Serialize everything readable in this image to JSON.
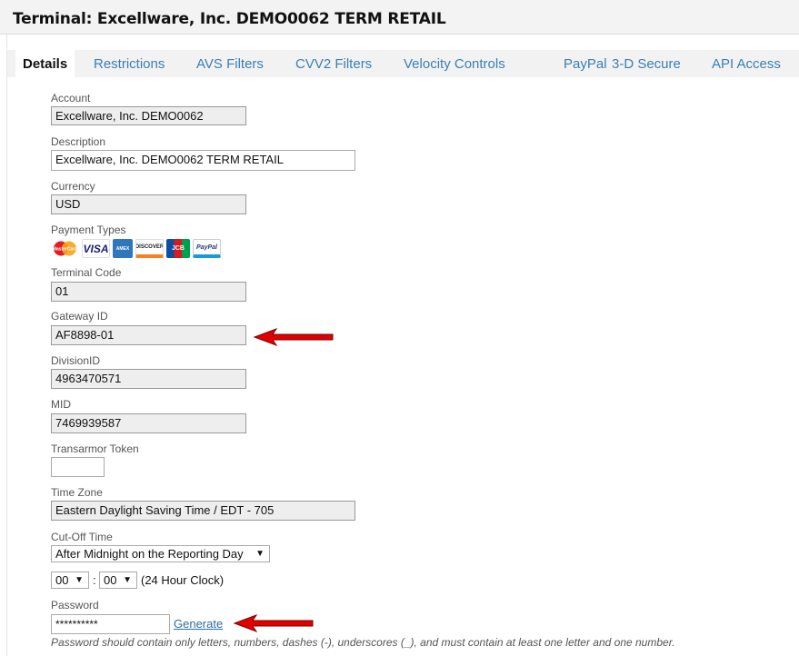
{
  "page": {
    "title": "Terminal: Excellware, Inc. DEMO0062 TERM RETAIL"
  },
  "tabs": [
    {
      "label": "Details"
    },
    {
      "label": "Restrictions"
    },
    {
      "label": "AVS Filters"
    },
    {
      "label": "CVV2 Filters"
    },
    {
      "label": "Velocity Controls"
    },
    {
      "label": "PayPal"
    },
    {
      "label": "3-D Secure"
    },
    {
      "label": "API Access"
    }
  ],
  "fields": {
    "account": {
      "label": "Account",
      "value": "Excellware, Inc. DEMO0062"
    },
    "description": {
      "label": "Description",
      "value": "Excellware, Inc. DEMO0062 TERM RETAIL"
    },
    "currency": {
      "label": "Currency",
      "value": "USD"
    },
    "payment_types": {
      "label": "Payment Types",
      "cards": [
        "MasterCard",
        "VISA",
        "AMEX",
        "DISCOVER",
        "JCB",
        "PayPal"
      ]
    },
    "terminal_code": {
      "label": "Terminal Code",
      "value": "01"
    },
    "gateway_id": {
      "label": "Gateway ID",
      "value": "AF8898-01"
    },
    "division_id": {
      "label": "DivisionID",
      "value": "4963470571"
    },
    "mid": {
      "label": "MID",
      "value": "7469939587"
    },
    "transarmor": {
      "label": "Transarmor Token",
      "value": ""
    },
    "time_zone": {
      "label": "Time Zone",
      "value": "Eastern Daylight Saving Time / EDT - 705"
    },
    "cutoff": {
      "label": "Cut-Off Time",
      "value": "After Midnight on the Reporting Day",
      "hour": "00",
      "colon": ":",
      "minute": "00",
      "clock_note": "(24 Hour Clock)"
    },
    "password": {
      "label": "Password",
      "value": "**********",
      "generate": "Generate",
      "hint": "Password should contain only letters, numbers, dashes (-), underscores (_), and must contain at least one letter and one number."
    }
  },
  "colors": {
    "link": "#2a6ea8",
    "arrow": "#e00000"
  }
}
